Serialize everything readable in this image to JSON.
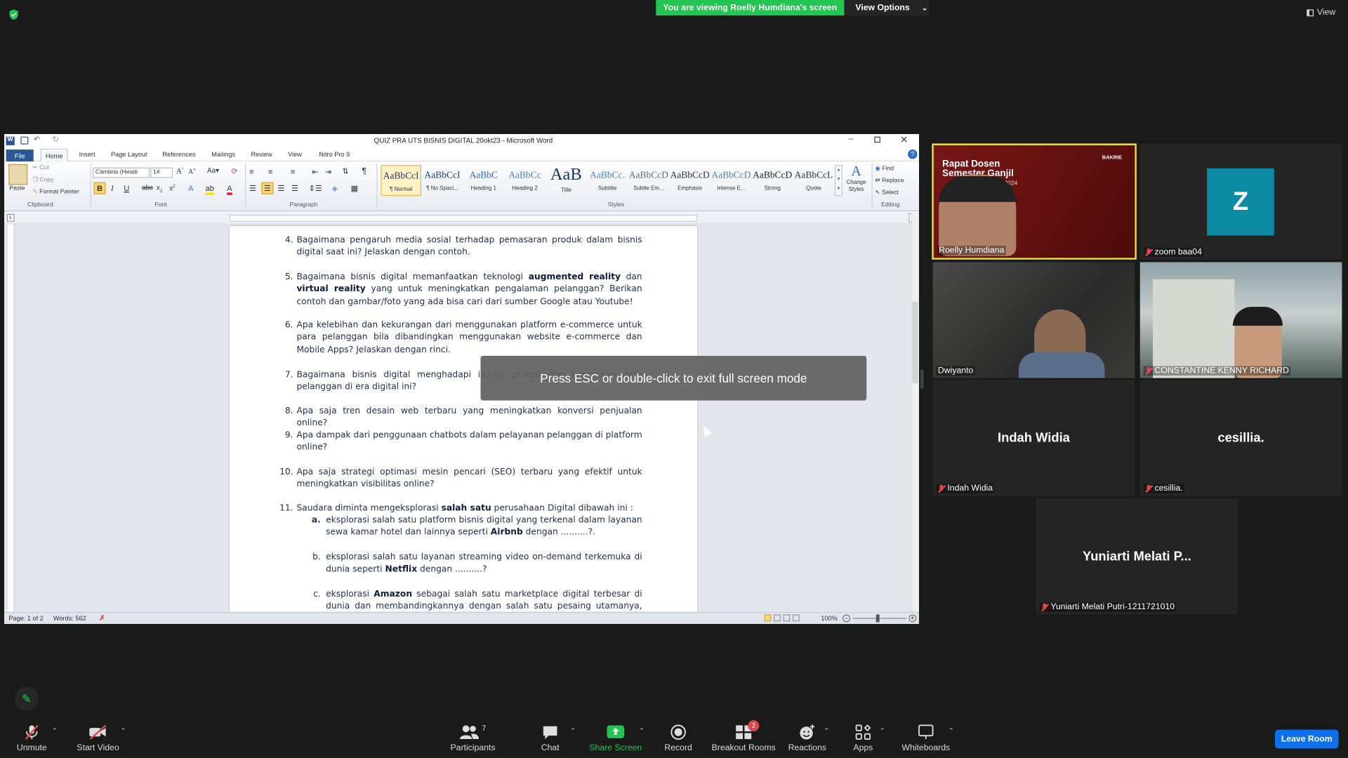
{
  "zoom": {
    "banner": "You are viewing Roelly Humdiana's screen",
    "view_options": "View Options",
    "view_button": "View",
    "esc_overlay": "Press ESC or double-click to exit full screen mode",
    "leave": "Leave Room",
    "toolbar": {
      "unmute": "Unmute",
      "start_video": "Start Video",
      "participants": "Participants",
      "participants_count": "7",
      "chat": "Chat",
      "share_screen": "Share Screen",
      "record": "Record",
      "breakout": "Breakout Rooms",
      "breakout_badge": "2",
      "reactions": "Reactions",
      "apps": "Apps",
      "whiteboards": "Whiteboards"
    },
    "participants": [
      {
        "name": "Roelly Humdiana",
        "slide_title": "Rapat Dosen Semester Ganjil",
        "slide_sub": "/2024",
        "logo": "BAKRIE"
      },
      {
        "name": "zoom baa04",
        "initial": "Z"
      },
      {
        "name": "Dwiyanto"
      },
      {
        "name": "CONSTANTINE KENNY RICHARD"
      },
      {
        "name": "Indah Widia",
        "center": "Indah Widia"
      },
      {
        "name": "cesillia.",
        "center": "cesillia."
      },
      {
        "name": "Yuniarti Melati Putri-1211721010",
        "center": "Yuniarti Melati P..."
      }
    ],
    "colors": {
      "accent_green": "#23c552",
      "leave_blue": "#0e71eb",
      "muted_red": "#e0464a"
    }
  },
  "word": {
    "title": "QUIZ PRA UTS BISNIS DIGITAL 20okt23  -  Microsoft Word",
    "tabs": [
      "File",
      "Home",
      "Insert",
      "Page Layout",
      "References",
      "Mailings",
      "Review",
      "View",
      "Nitro Pro 9"
    ],
    "clipboard": {
      "paste": "Paste",
      "cut": "Cut",
      "copy": "Copy",
      "format_painter": "Format Painter",
      "label": "Clipboard"
    },
    "font": {
      "name": "Cambria (Headi",
      "size": "14",
      "label": "Font"
    },
    "paragraph_label": "Paragraph",
    "styles_label": "Styles",
    "editing": {
      "find": "Find",
      "replace": "Replace",
      "select": "Select",
      "label": "Editing"
    },
    "change_styles": "Change Styles",
    "styles": [
      {
        "preview": "AaBbCcI",
        "name": "¶ Normal"
      },
      {
        "preview": "AaBbCcI",
        "name": "¶ No Spaci..."
      },
      {
        "preview": "AaBbC",
        "name": "Heading 1"
      },
      {
        "preview": "AaBbCc",
        "name": "Heading 2"
      },
      {
        "preview": "AaB",
        "name": "Title"
      },
      {
        "preview": "AaBbCc.",
        "name": "Subtitle"
      },
      {
        "preview": "AaBbCcD",
        "name": "Subtle Em..."
      },
      {
        "preview": "AaBbCcD",
        "name": "Emphasis"
      },
      {
        "preview": "AaBbCcD",
        "name": "Intense E..."
      },
      {
        "preview": "AaBbCcD",
        "name": "Strong"
      },
      {
        "preview": "AaBbCcL",
        "name": "Quote"
      }
    ],
    "status": {
      "page": "Page: 1 of 2",
      "words": "Words: 562",
      "zoom": "100%"
    },
    "questions": {
      "q4": {
        "n": "4.",
        "html": "Bagaimana pengaruh media sosial terhadap pemasaran produk dalam bisnis digital saat ini? Jelaskan dengan contoh."
      },
      "q5": {
        "n": "5."
      },
      "q6": {
        "n": "6.",
        "text": "Apa kelebihan dan kekurangan dari menggunakan platform e-commerce untuk para pelanggan bila dibandingkan menggunakan website e-commerce dan Mobile Apps? Jelaskan dengan rinci."
      },
      "q7": {
        "n": "7.",
        "text": "Bagaimana bisnis digital menghadapi isu-isu privasi dan keamanan data pelanggan di era digital ini?"
      },
      "q8": {
        "n": "8.",
        "text": "Apa saja tren desain web terbaru yang meningkatkan konversi penjualan online?"
      },
      "q9": {
        "n": "9.",
        "text": "Apa dampak dari penggunaan chatbots dalam pelayanan pelanggan di platform online?"
      },
      "q10": {
        "n": "10.",
        "text": "Apa saja strategi optimasi mesin pencari (SEO) terbaru yang efektif untuk meningkatkan visibilitas online?"
      },
      "q11": {
        "n": "11."
      },
      "q11a": {
        "n": "a."
      },
      "q11b": {
        "n": "b."
      },
      "q11c": {
        "n": "c."
      }
    }
  }
}
